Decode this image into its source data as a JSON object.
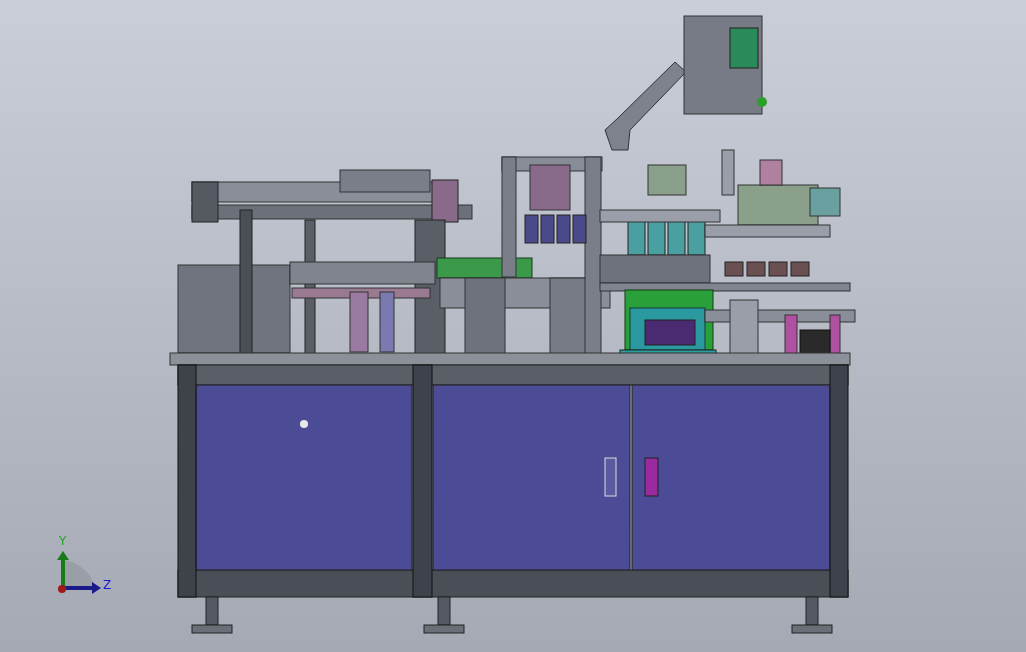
{
  "viewport": {
    "axis_triad": {
      "labels": [
        "Y",
        "Z"
      ]
    }
  }
}
